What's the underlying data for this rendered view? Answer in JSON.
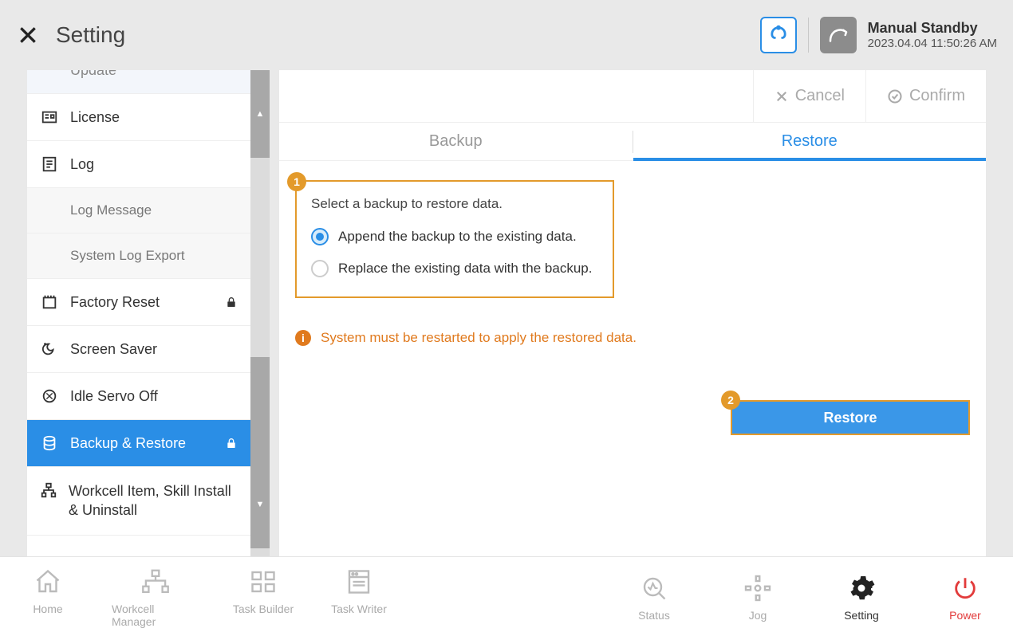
{
  "header": {
    "title": "Setting",
    "status_title": "Manual Standby",
    "status_time": "2023.04.04 11:50:26 AM"
  },
  "sidebar": {
    "items": [
      {
        "label": "Update"
      },
      {
        "label": "License"
      },
      {
        "label": "Log"
      },
      {
        "label": "Log Message"
      },
      {
        "label": "System Log Export"
      },
      {
        "label": "Factory Reset"
      },
      {
        "label": "Screen Saver"
      },
      {
        "label": "Idle Servo Off"
      },
      {
        "label": "Backup & Restore"
      },
      {
        "label": "Workcell Item, Skill Install & Uninstall"
      }
    ]
  },
  "actions": {
    "cancel": "Cancel",
    "confirm": "Confirm"
  },
  "tabs": {
    "backup": "Backup",
    "restore": "Restore"
  },
  "restore_panel": {
    "callout_num": "1",
    "title": "Select a backup to restore data.",
    "option_append": "Append the backup to the existing data.",
    "option_replace": "Replace the existing data with the backup.",
    "info": "System must be restarted to apply the restored data.",
    "button_num": "2",
    "button_label": "Restore"
  },
  "bottom_nav": {
    "home": "Home",
    "workcell": "Workcell Manager",
    "task_builder": "Task Builder",
    "task_writer": "Task Writer",
    "status": "Status",
    "jog": "Jog",
    "setting": "Setting",
    "power": "Power"
  }
}
